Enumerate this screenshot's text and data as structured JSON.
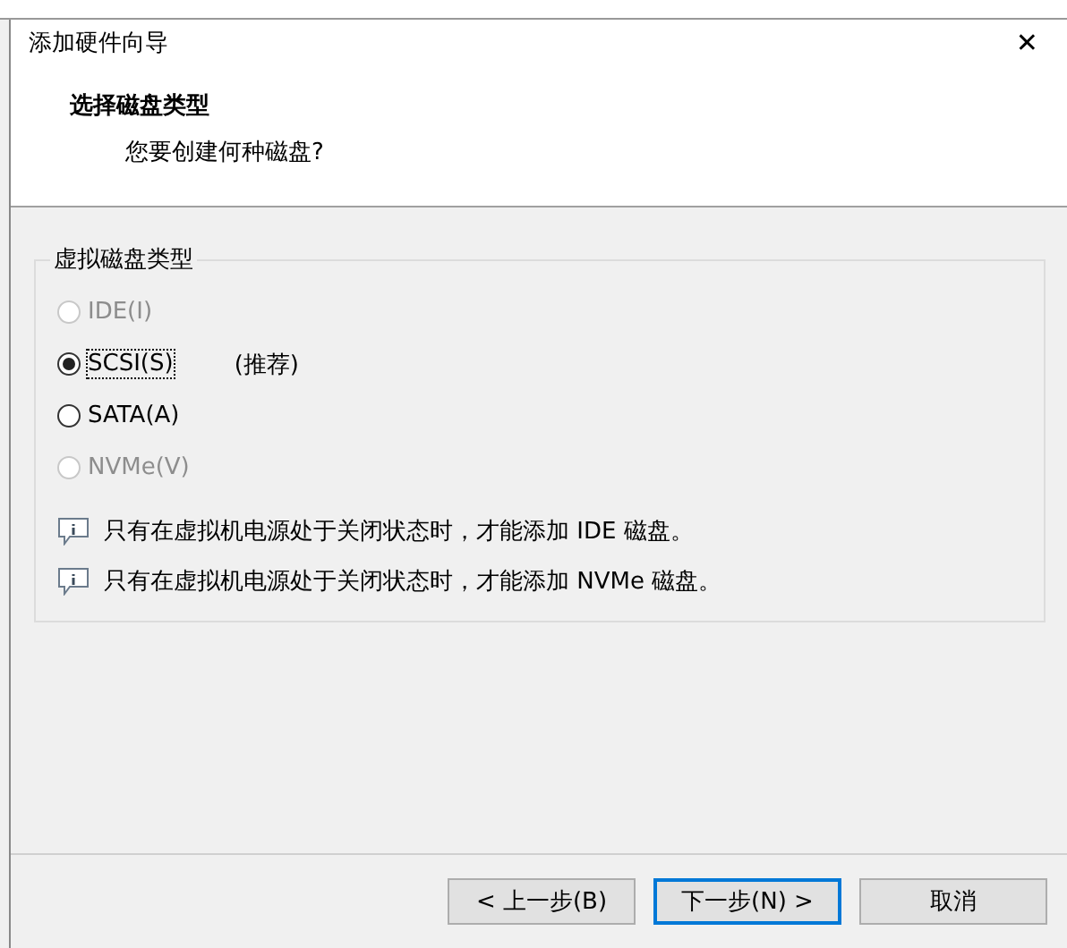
{
  "window": {
    "title": "添加硬件向导",
    "close": "✕"
  },
  "header": {
    "title": "选择磁盘类型",
    "subtitle": "您要创建何种磁盘?"
  },
  "group": {
    "title": "虚拟磁盘类型",
    "options": [
      {
        "label": "IDE(I)",
        "selected": false,
        "disabled": true
      },
      {
        "label": "SCSI(S)",
        "selected": true,
        "disabled": false,
        "note": "(推荐)"
      },
      {
        "label": "SATA(A)",
        "selected": false,
        "disabled": false
      },
      {
        "label": "NVMe(V)",
        "selected": false,
        "disabled": true
      }
    ],
    "infos": [
      "只有在虚拟机电源处于关闭状态时，才能添加 IDE 磁盘。",
      "只有在虚拟机电源处于关闭状态时，才能添加 NVMe 磁盘。"
    ]
  },
  "buttons": [
    {
      "label": "< 上一步(B)",
      "default": false
    },
    {
      "label": "下一步(N) >",
      "default": true
    },
    {
      "label": "取消",
      "default": false
    }
  ]
}
